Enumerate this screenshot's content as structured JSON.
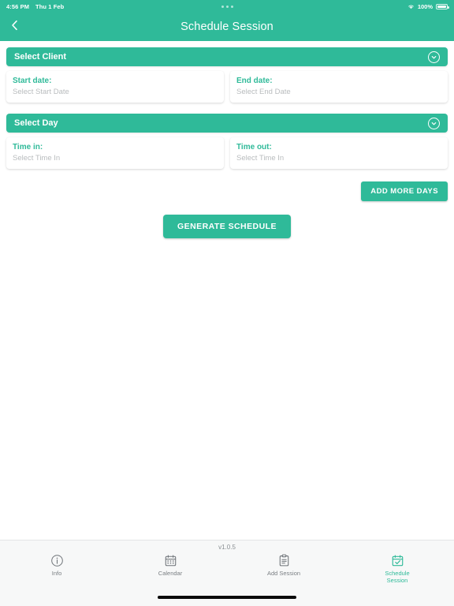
{
  "status_bar": {
    "time": "4:56 PM",
    "date": "Thu 1 Feb",
    "battery_percent": "100%",
    "wifi_icon": "wifi-icon",
    "battery_icon": "battery-icon",
    "multitask_icon": "multitask-dots-icon"
  },
  "nav": {
    "back_icon": "chevron-left-icon",
    "title": "Schedule Session"
  },
  "client_section": {
    "header_label": "Select Client",
    "header_icon": "chevron-down-circle-icon",
    "start_date": {
      "label": "Start date:",
      "value": "",
      "placeholder": "Select Start Date"
    },
    "end_date": {
      "label": "End date:",
      "value": "",
      "placeholder": "Select End Date"
    }
  },
  "day_section": {
    "header_label": "Select Day",
    "header_icon": "chevron-down-circle-icon",
    "time_in": {
      "label": "Time in:",
      "value": "",
      "placeholder": "Select Time In"
    },
    "time_out": {
      "label": "Time out:",
      "value": "",
      "placeholder": "Select Time In"
    }
  },
  "actions": {
    "add_more_days": "ADD MORE DAYS",
    "generate_schedule": "GENERATE SCHEDULE"
  },
  "footer": {
    "version": "v1.0.5"
  },
  "tabbar": {
    "items": [
      {
        "label": "Info",
        "icon": "info-circle-icon",
        "active": false
      },
      {
        "label": "Calendar",
        "icon": "calendar-icon",
        "active": false
      },
      {
        "label": "Add Session",
        "icon": "clipboard-icon",
        "active": false
      },
      {
        "label": "Schedule\nSession",
        "label_line1": "Schedule",
        "label_line2": "Session",
        "icon": "calendar-check-icon",
        "active": true
      }
    ]
  },
  "colors": {
    "brand_green": "#2fba99",
    "placeholder_gray": "#b9bcbe",
    "tab_inactive": "#7a7f83",
    "page_bg": "#ffffff",
    "tabbar_bg": "#f7f8f8"
  }
}
